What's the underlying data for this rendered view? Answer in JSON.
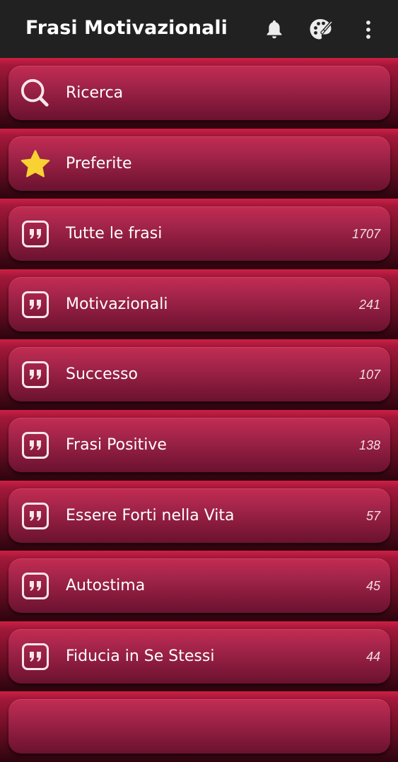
{
  "app_bar": {
    "title": "Frasi Motivazionali",
    "actions": [
      {
        "name": "notifications",
        "icon": "bell-icon"
      },
      {
        "name": "theme",
        "icon": "palette-icon"
      },
      {
        "name": "more",
        "icon": "more-vertical-icon"
      }
    ]
  },
  "menu": {
    "search": {
      "label": "Ricerca",
      "icon": "search-icon"
    },
    "favorites": {
      "label": "Preferite",
      "icon": "star-icon"
    },
    "categories": [
      {
        "label": "Tutte le frasi",
        "count": "1707",
        "icon": "quote-icon"
      },
      {
        "label": "Motivazionali",
        "count": "241",
        "icon": "quote-icon"
      },
      {
        "label": "Successo",
        "count": "107",
        "icon": "quote-icon"
      },
      {
        "label": "Frasi Positive",
        "count": "138",
        "icon": "quote-icon"
      },
      {
        "label": "Essere Forti nella Vita",
        "count": "57",
        "icon": "quote-icon"
      },
      {
        "label": "Autostima",
        "count": "45",
        "icon": "quote-icon"
      },
      {
        "label": "Fiducia in Se Stessi",
        "count": "44",
        "icon": "quote-icon"
      }
    ]
  },
  "colors": {
    "app_bar": "#212121",
    "card": "#a3244a",
    "star": "#f7d232",
    "icon_light": "#f7e6ea"
  }
}
